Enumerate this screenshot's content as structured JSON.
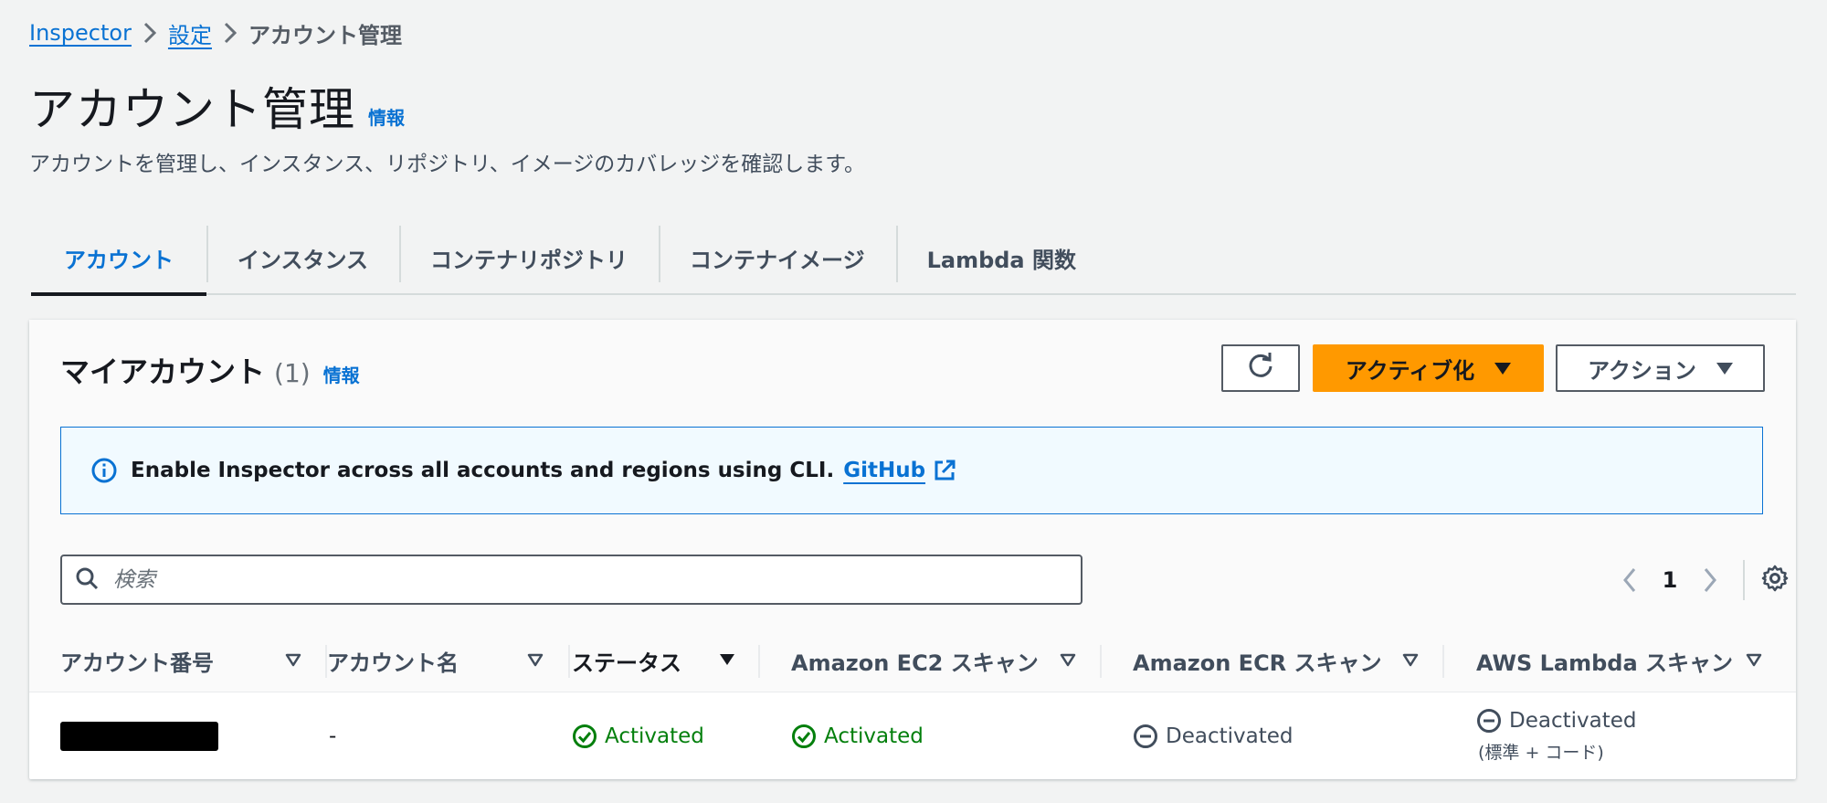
{
  "breadcrumb": {
    "items": [
      "Inspector",
      "設定"
    ],
    "current": "アカウント管理"
  },
  "page": {
    "title": "アカウント管理",
    "info": "情報",
    "description": "アカウントを管理し、インスタンス、リポジトリ、イメージのカバレッジを確認します。"
  },
  "tabs": [
    {
      "label": "アカウント",
      "active": true
    },
    {
      "label": "インスタンス"
    },
    {
      "label": "コンテナリポジトリ"
    },
    {
      "label": "コンテナイメージ"
    },
    {
      "label": "Lambda 関数"
    }
  ],
  "panel": {
    "title": "マイアカウント",
    "count": "(1)",
    "info": "情報",
    "activate_label": "アクティブ化",
    "actions_label": "アクション"
  },
  "alert": {
    "text": "Enable Inspector across all accounts and regions using CLI.",
    "link": "GitHub"
  },
  "search": {
    "placeholder": "検索",
    "value": ""
  },
  "pagination": {
    "page": "1"
  },
  "table": {
    "columns": [
      "アカウント番号",
      "アカウント名",
      "ステータス",
      "Amazon EC2 スキャン",
      "Amazon ECR スキャン",
      "AWS Lambda スキャン"
    ],
    "sorted_column": "ステータス",
    "rows": [
      {
        "account_id": "",
        "account_name": "-",
        "status": "Activated",
        "ec2": "Activated",
        "ecr": "Deactivated",
        "lambda": "Deactivated",
        "lambda_sub": "(標準 + コード)"
      }
    ]
  },
  "colors": {
    "link": "#0972d3",
    "primary_button": "#ff9900",
    "success": "#037f0c",
    "background": "#f2f3f3"
  }
}
